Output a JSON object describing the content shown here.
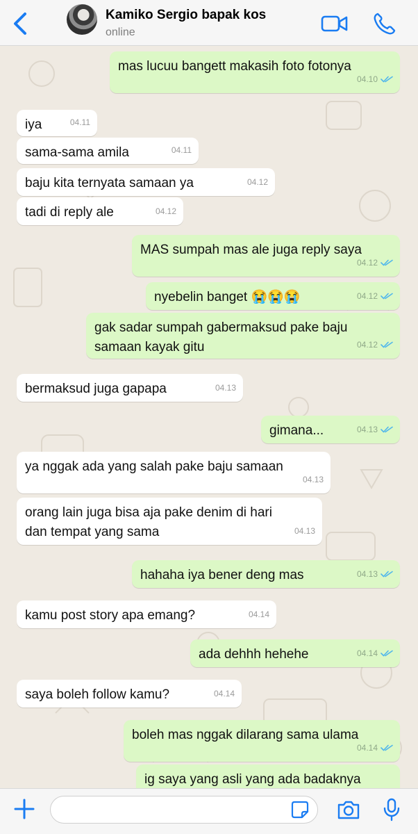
{
  "header": {
    "contact_name": "Kamiko Sergio bapak kos",
    "status": "online"
  },
  "colors": {
    "accent": "#1a7cf2",
    "incoming_bubble": "#ffffff",
    "outgoing_bubble": "#dcf8c6",
    "read_ticks": "#4fb6ec",
    "wallpaper": "#efeae2"
  },
  "icons": {
    "back": "chevron-left-icon",
    "video_call": "video-camera-icon",
    "voice_call": "phone-icon",
    "attach": "plus-icon",
    "sticker": "sticker-icon",
    "camera": "camera-icon",
    "voice_note": "microphone-icon"
  },
  "messages": [
    {
      "dir": "out",
      "text": "mas lucuu bangett makasih foto fotonya",
      "time": "04.10",
      "read": true
    },
    {
      "dir": "in",
      "text": "iya",
      "time": "04.11"
    },
    {
      "dir": "in",
      "text": "sama-sama amila",
      "time": "04.11"
    },
    {
      "dir": "in",
      "text": "baju kita ternyata samaan ya",
      "time": "04.12"
    },
    {
      "dir": "in",
      "text": "tadi di reply ale",
      "time": "04.12"
    },
    {
      "dir": "out",
      "text": "MAS sumpah mas ale juga reply saya",
      "time": "04.12",
      "read": true
    },
    {
      "dir": "out",
      "text": "nyebelin banget 😭😭😭",
      "time": "04.12",
      "read": true
    },
    {
      "dir": "out",
      "text": "gak sadar sumpah gabermaksud pake baju\nsamaan kayak gitu",
      "time": "04.12",
      "read": true
    },
    {
      "dir": "in",
      "text": "bermaksud juga gapapa",
      "time": "04.13"
    },
    {
      "dir": "out",
      "text": "gimana...",
      "time": "04.13",
      "read": true
    },
    {
      "dir": "in",
      "text": "ya nggak ada yang salah pake baju samaan",
      "time": "04.13"
    },
    {
      "dir": "in",
      "text": "orang lain juga bisa aja pake denim di hari\ndan tempat yang sama",
      "time": "04.13"
    },
    {
      "dir": "out",
      "text": "hahaha iya bener deng mas",
      "time": "04.13",
      "read": true
    },
    {
      "dir": "in",
      "text": "kamu post story apa emang?",
      "time": "04.14"
    },
    {
      "dir": "out",
      "text": "ada dehhh hehehe",
      "time": "04.14",
      "read": true
    },
    {
      "dir": "in",
      "text": "saya boleh follow kamu?",
      "time": "04.14"
    },
    {
      "dir": "out",
      "text": "boleh mas nggak dilarang sama ulama",
      "time": "04.14",
      "read": true
    },
    {
      "dir": "out",
      "text": "ig saya yang asli yang ada badaknya",
      "time": "",
      "read": false
    }
  ],
  "composer": {
    "placeholder": ""
  }
}
